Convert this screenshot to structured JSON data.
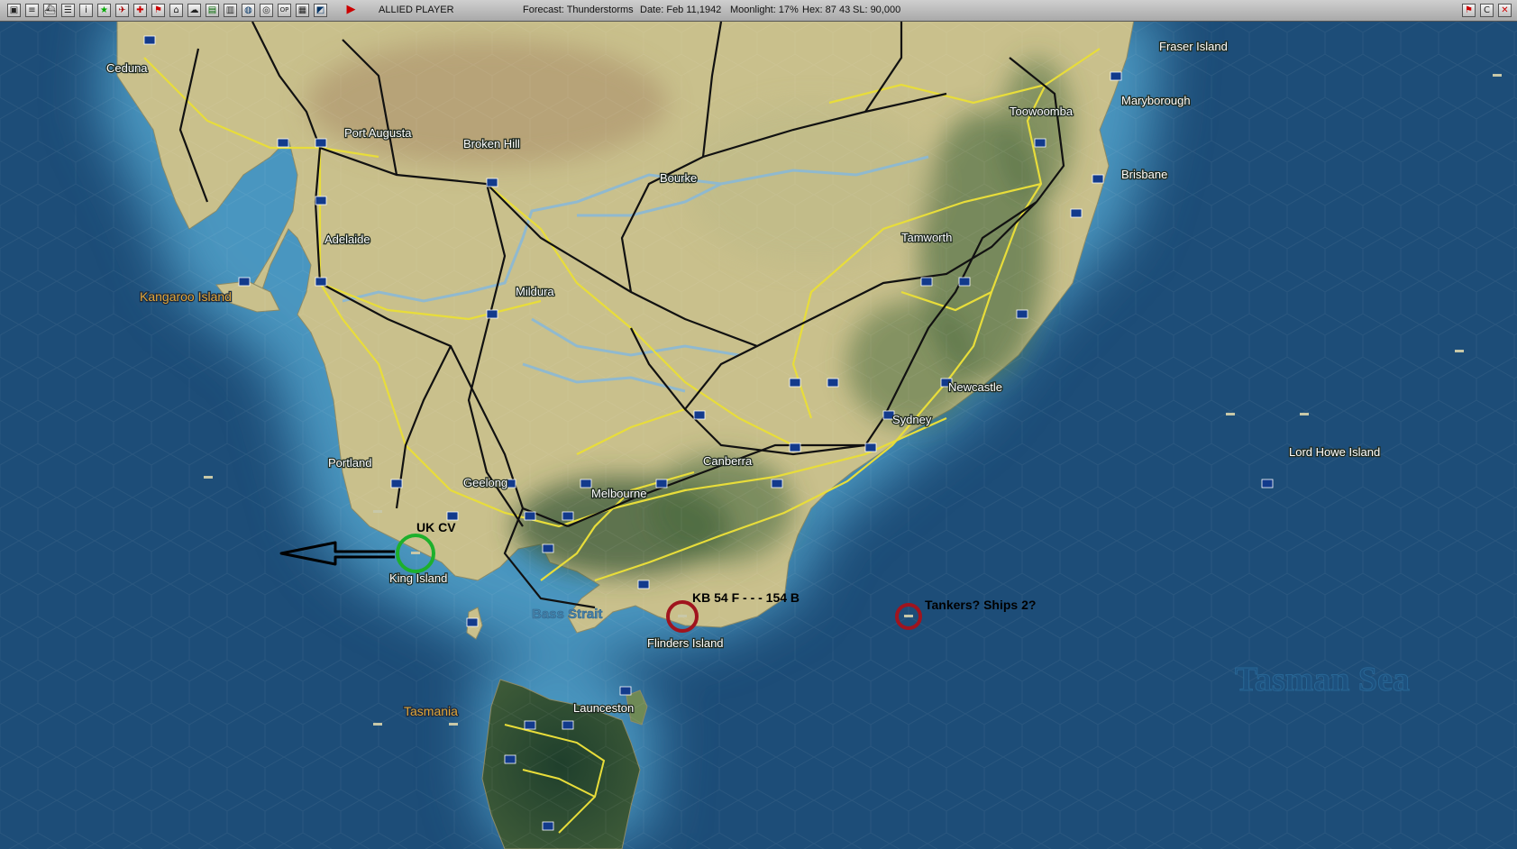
{
  "toolbar": {
    "player": "ALLIED PLAYER",
    "forecast": "Forecast: Thunderstorms",
    "date": "Date: Feb 11,1942",
    "moonlight": "Moonlight: 17%",
    "hex": "Hex: 87 43",
    "sl": "SL: 90,000",
    "buttons": [
      "square-icon",
      "document-icon",
      "ship-icon",
      "list-icon",
      "info-icon",
      "star-icon",
      "plane-icon",
      "cross-icon",
      "flag-icon",
      "base-icon",
      "cloud-icon",
      "chart-icon",
      "hq-icon",
      "globe-icon",
      "target-icon",
      "op-icon",
      "report-icon",
      "window-icon"
    ],
    "play_icon": "play-icon",
    "right_buttons": [
      "flag-toggle-icon",
      "c-icon",
      "close-icon"
    ],
    "op_label": "OP"
  },
  "map": {
    "places": {
      "ceduna": "Ceduna",
      "port_augusta": "Port Augusta",
      "broken_hill": "Broken Hill",
      "bourke": "Bourke",
      "toowoomba": "Toowoomba",
      "fraser_island": "Fraser Island",
      "maryborough": "Maryborough",
      "brisbane": "Brisbane",
      "adelaide": "Adelaide",
      "kangaroo_island": "Kangaroo Island",
      "mildura": "Mildura",
      "tamworth": "Tamworth",
      "newcastle": "Newcastle",
      "sydney": "Sydney",
      "lord_howe_island": "Lord Howe Island",
      "portland": "Portland",
      "geelong": "Geelong",
      "melbourne": "Melbourne",
      "canberra": "Canberra",
      "king_island": "King Island",
      "bass_strait": "Bass Strait",
      "flinders_island": "Flinders Island",
      "tasmania": "Tasmania",
      "launceston": "Launceston",
      "tasman_sea": "Tasman Sea"
    },
    "annotations": {
      "uk_cv": "UK CV",
      "kb": "KB 54 F - - - 154 B",
      "tankers": "Tankers? Ships 2?"
    },
    "colors": {
      "sea": "#1d4d78",
      "shallow": "#4f9fc8",
      "land": "#c9c08c",
      "rail": "#111111",
      "road": "#e8dd3a",
      "river": "#8ab8d6",
      "green_circle": "#1db02c",
      "red_circle": "#a0141e"
    }
  }
}
